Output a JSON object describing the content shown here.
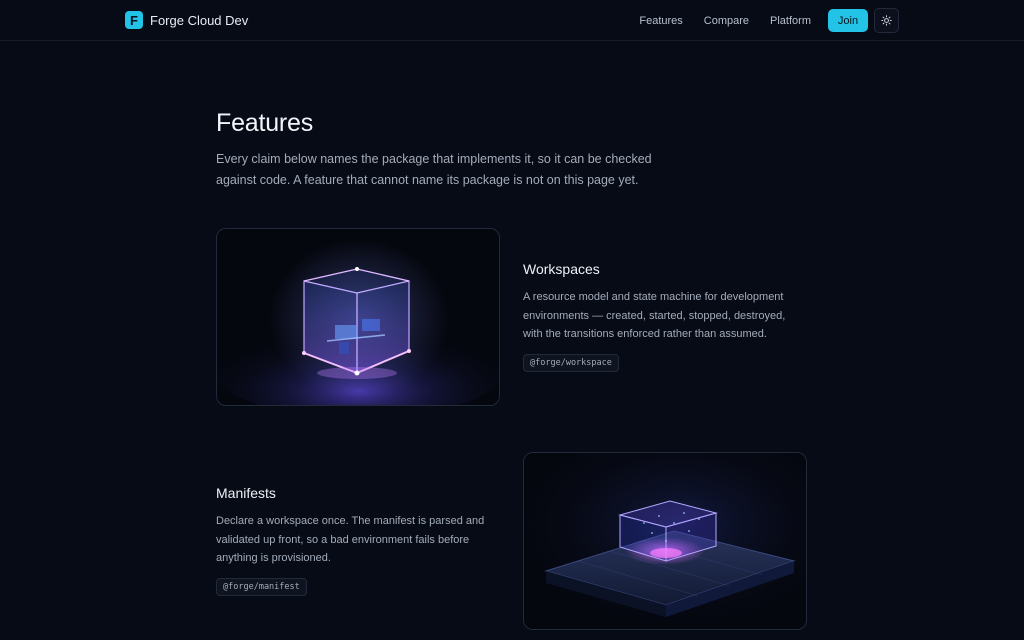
{
  "header": {
    "brand_letter": "F",
    "brand_name": "Forge Cloud Dev",
    "nav": [
      "Features",
      "Compare",
      "Platform"
    ],
    "join_label": "Join",
    "theme_icon": "sun-icon",
    "accent": "#22c3e6"
  },
  "main": {
    "title": "Features",
    "intro": "Every claim below names the package that implements it, so it can be checked against code. A feature that cannot name its package is not on this page yet.",
    "features": [
      {
        "title": "Workspaces",
        "description": "A resource model and state machine for development environments — created, started, stopped, destroyed, with the transitions enforced rather than assumed.",
        "package": "@forge/workspace",
        "image": "glowing-cube-workstation-illustration"
      },
      {
        "title": "Manifests",
        "description": "Declare a workspace once. The manifest is parsed and validated up front, so a bad environment fails before anything is provisioned.",
        "package": "@forge/manifest",
        "image": "glowing-box-on-platform-illustration"
      }
    ]
  }
}
